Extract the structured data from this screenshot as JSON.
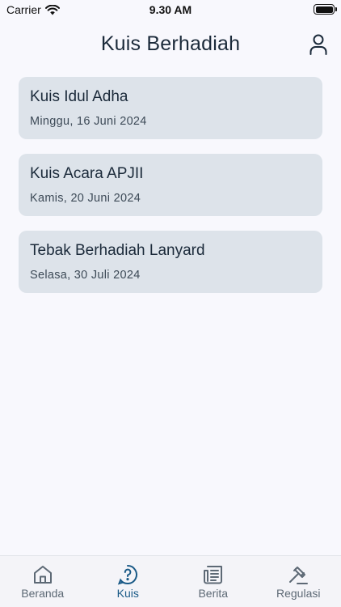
{
  "status_bar": {
    "carrier": "Carrier",
    "time": "9.30 AM"
  },
  "header": {
    "title": "Kuis Berhadiah",
    "profile_icon": "person-icon"
  },
  "quizzes": [
    {
      "title": "Kuis Idul Adha",
      "date": "Minggu, 16 Juni 2024"
    },
    {
      "title": "Kuis Acara APJII",
      "date": "Kamis, 20 Juni 2024"
    },
    {
      "title": "Tebak Berhadiah Lanyard",
      "date": "Selasa, 30 Juli 2024"
    }
  ],
  "tabbar": {
    "active": "Kuis",
    "items": [
      {
        "label": "Beranda",
        "icon": "home-icon"
      },
      {
        "label": "Kuis",
        "icon": "question-bubble-icon"
      },
      {
        "label": "Berita",
        "icon": "newspaper-icon"
      },
      {
        "label": "Regulasi",
        "icon": "gavel-icon"
      }
    ]
  },
  "colors": {
    "background": "#f8f8fd",
    "card": "#dde3ea",
    "accent": "#1a5a87",
    "text": "#1b2a3a"
  }
}
